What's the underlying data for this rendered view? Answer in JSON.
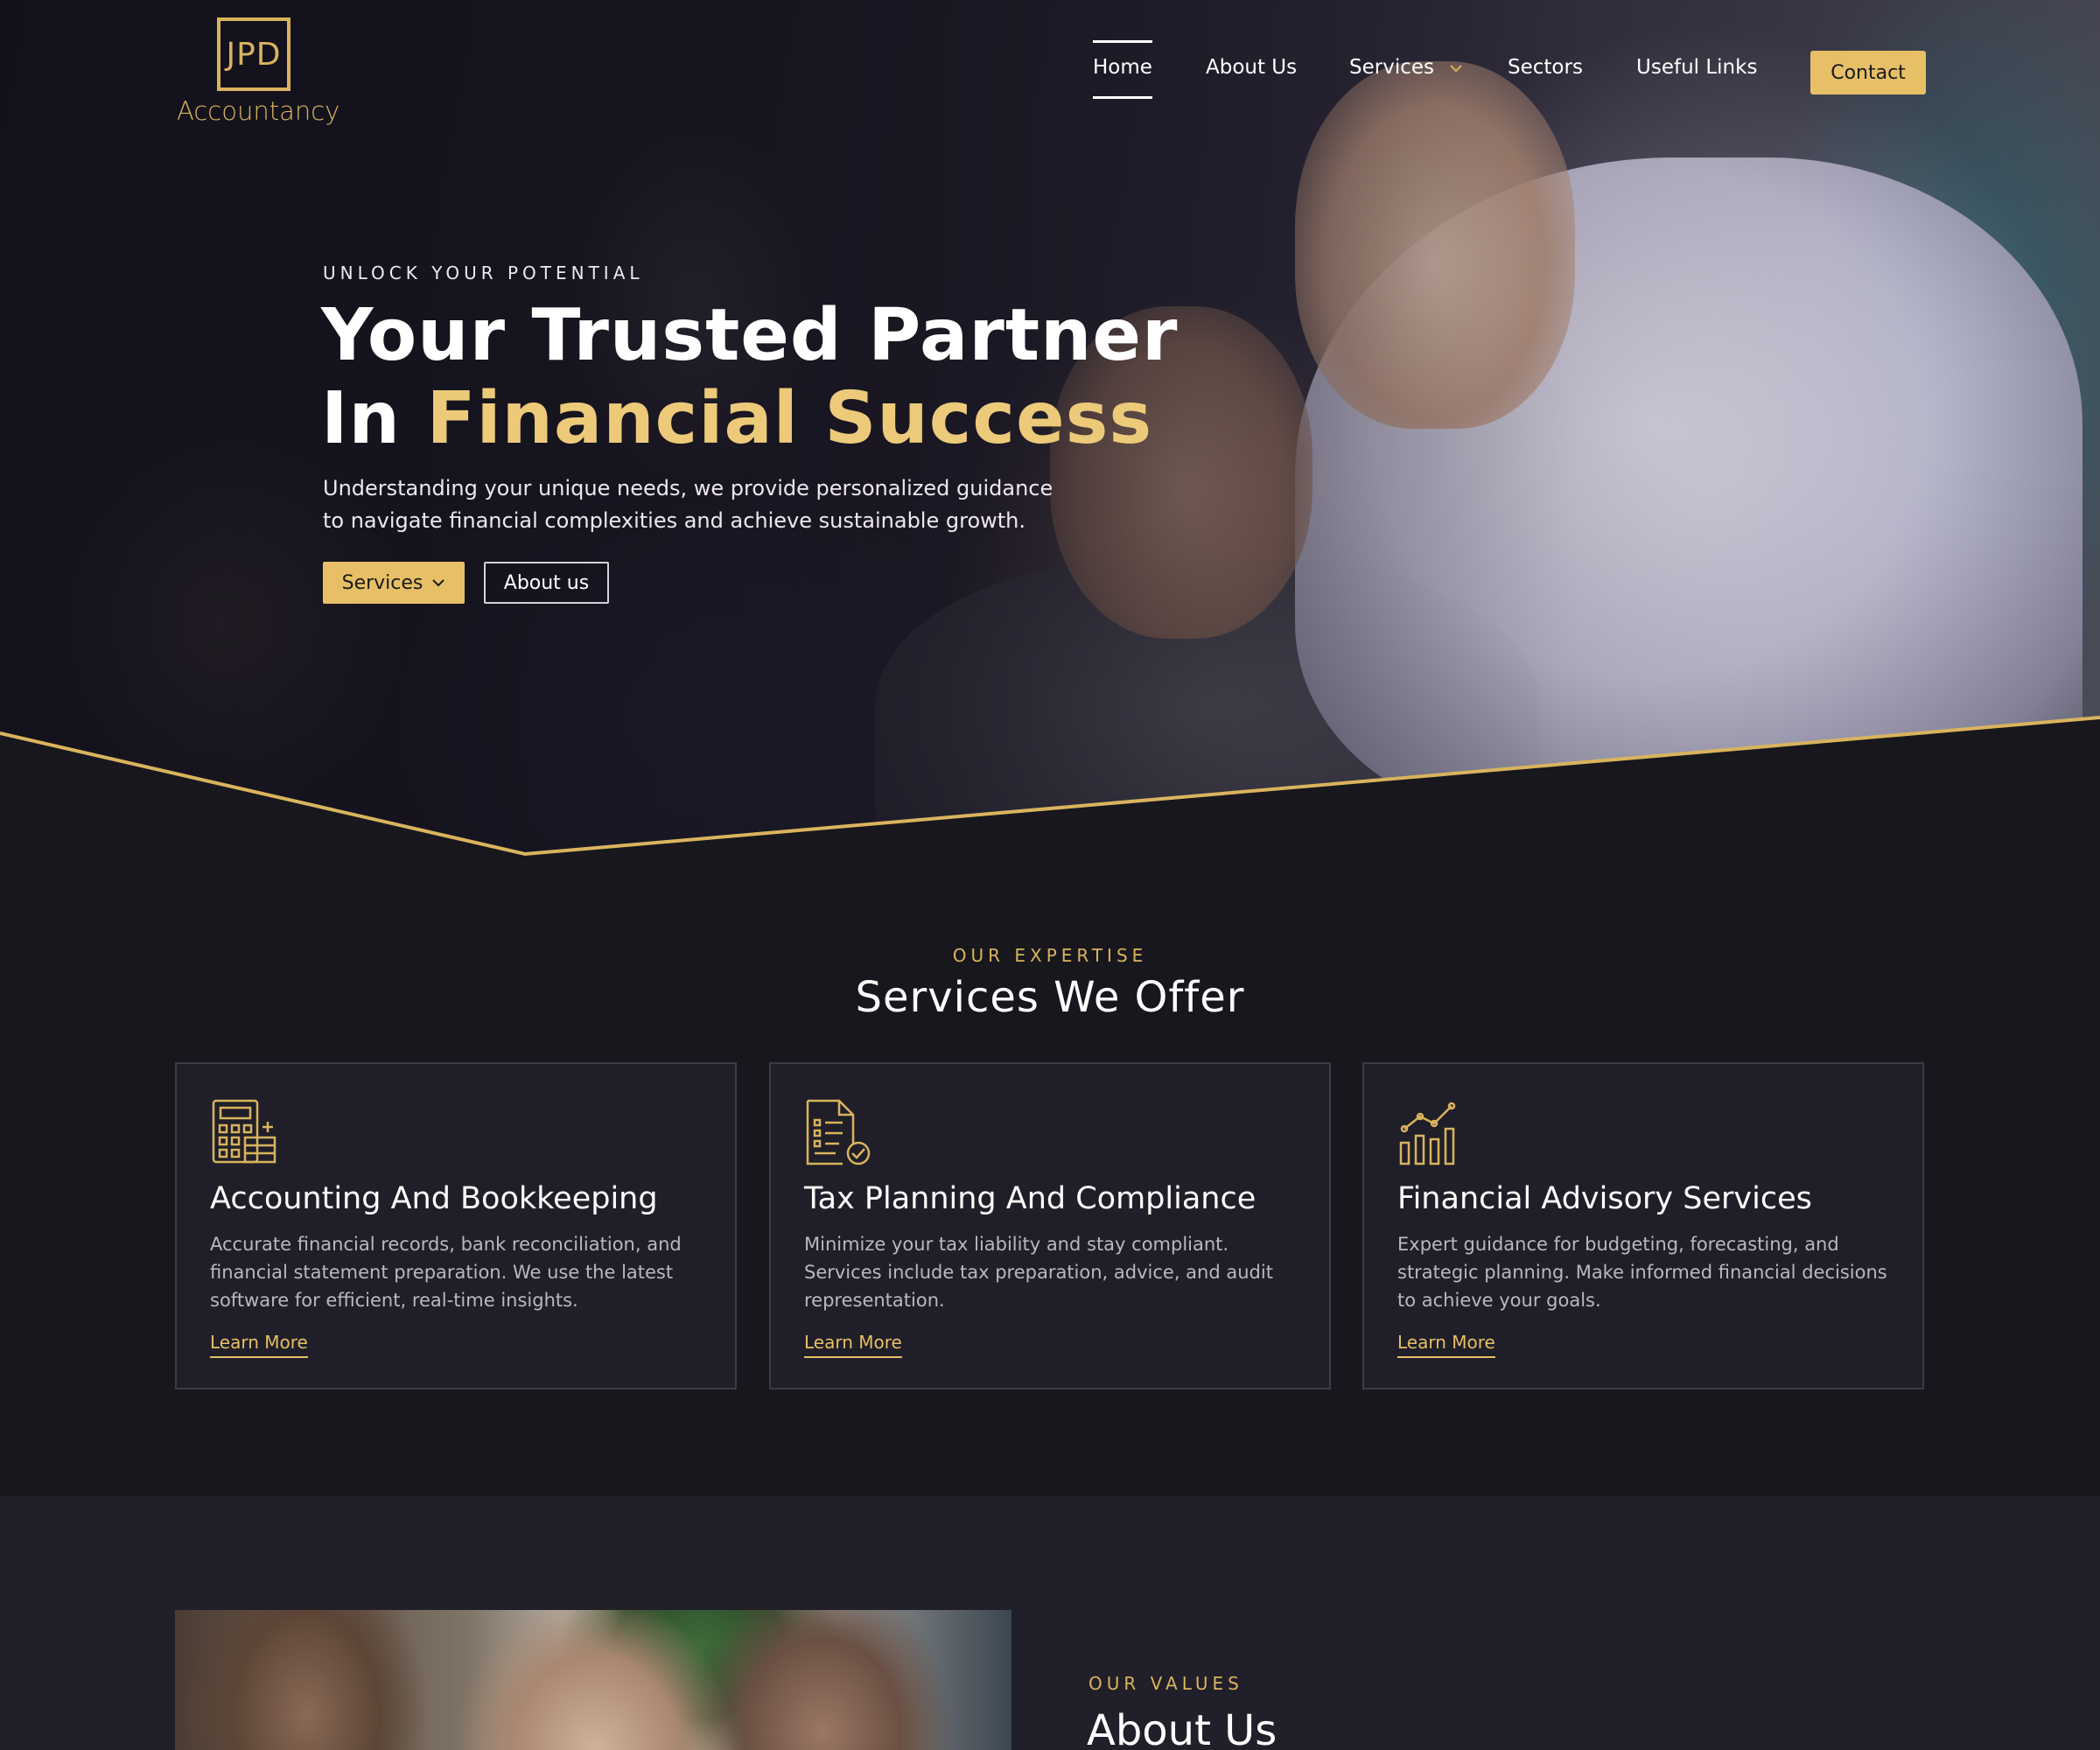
{
  "brand": {
    "logo_mark": "JPD",
    "name": "Accountancy",
    "accent": "#e7bf66"
  },
  "nav": {
    "items": [
      {
        "label": "Home",
        "active": true
      },
      {
        "label": "About Us"
      },
      {
        "label": "Services",
        "has_dropdown": true
      },
      {
        "label": "Sectors"
      },
      {
        "label": "Useful Links"
      }
    ],
    "cta": "Contact"
  },
  "hero": {
    "eyebrow": "UNLOCK YOUR POTENTIAL",
    "title_line1": "Your Trusted Partner",
    "title_line2_prefix": "In ",
    "title_line2_highlight": "Financial Success",
    "subtitle": "Understanding your unique needs, we provide personalized guidance to navigate financial complexities and achieve sustainable growth.",
    "btn_primary": "Services",
    "btn_secondary": "About us"
  },
  "services": {
    "eyebrow": "OUR EXPERTISE",
    "title": "Services We Offer",
    "cards": [
      {
        "icon": "calculator-icon",
        "title": "Accounting And Bookkeeping",
        "body": "Accurate financial records, bank reconciliation, and financial statement preparation. We use the latest software for efficient, real-time insights.",
        "link": "Learn More"
      },
      {
        "icon": "tax-document-icon",
        "title": "Tax Planning And Compliance",
        "body": "Minimize your tax liability and stay compliant. Services include tax preparation, advice, and audit representation.",
        "link": "Learn More"
      },
      {
        "icon": "growth-chart-icon",
        "title": "Financial Advisory Services",
        "body": "Expert guidance for budgeting, forecasting, and strategic planning. Make informed financial decisions to achieve your goals.",
        "link": "Learn More"
      }
    ]
  },
  "about": {
    "eyebrow": "OUR VALUES",
    "title": "About Us"
  }
}
